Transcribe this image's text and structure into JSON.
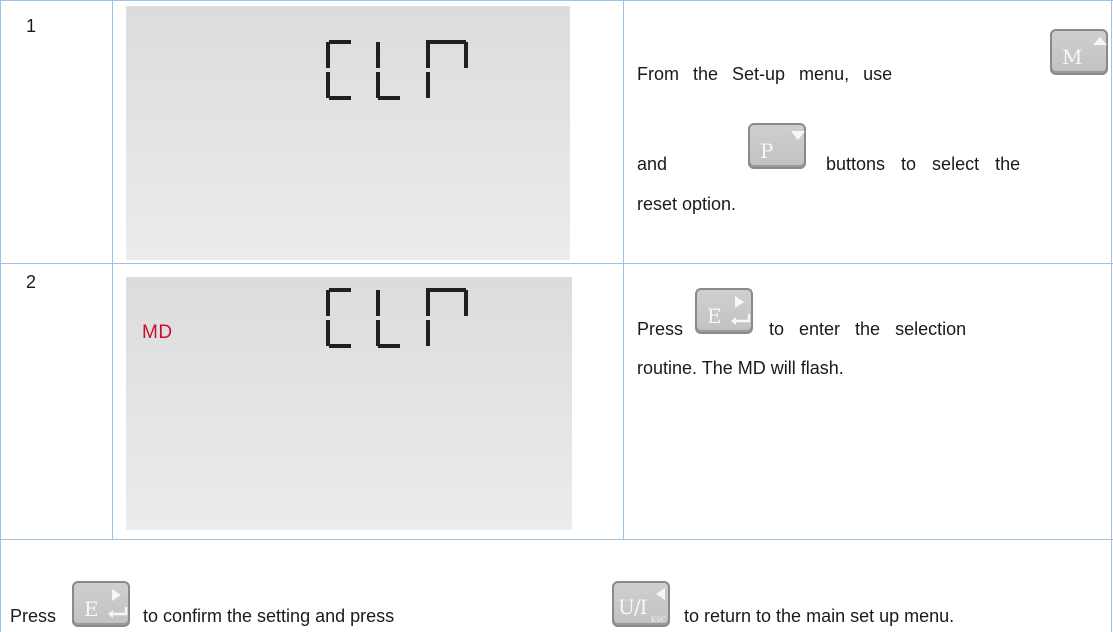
{
  "steps": [
    {
      "number": "1",
      "display": {
        "code": "CLR"
      },
      "text": {
        "line1": "From the Set-up menu, use",
        "line2_start": "and",
        "line2_end": "buttons to select the",
        "line3": "reset option."
      },
      "keys": [
        {
          "label": "M",
          "icon": "up-arrow-icon"
        },
        {
          "label": "P",
          "icon": "down-arrow-icon"
        }
      ]
    },
    {
      "number": "2",
      "display": {
        "code": "CLR",
        "indicator": "MD",
        "indicator_color": "#c8102e"
      },
      "text": {
        "line1_start": "Press",
        "line1_end": "to enter the selection",
        "line2": "routine. The MD will flash."
      },
      "keys": [
        {
          "label": "E",
          "icon": "right-arrow-enter-icon"
        }
      ]
    }
  ],
  "footer": {
    "text_press": "Press",
    "text_mid": "to confirm the setting and press",
    "text_end": "to return to the main set up menu.",
    "keys": [
      {
        "label": "E",
        "icon": "right-arrow-enter-icon"
      },
      {
        "label": "U/I",
        "sub": "ESC",
        "icon": "left-arrow-icon"
      }
    ]
  },
  "colors": {
    "table_border": "#9ec3e6",
    "indicator": "#c8102e"
  }
}
